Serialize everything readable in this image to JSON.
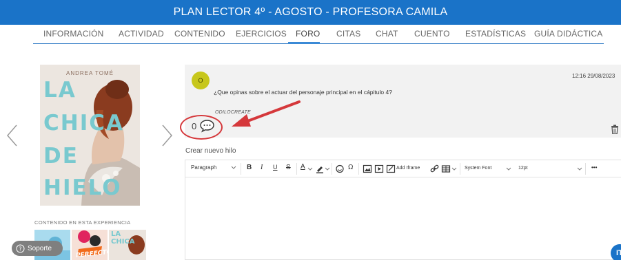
{
  "header": {
    "title": "PLAN LECTOR 4º - AGOSTO - PROFESORA CAMILA"
  },
  "tabs": [
    {
      "label": "INFORMACIÓN"
    },
    {
      "label": "ACTIVIDAD"
    },
    {
      "label": "CONTENIDO"
    },
    {
      "label": "EJERCICIOS"
    },
    {
      "label": "FORO",
      "active": true
    },
    {
      "label": "CITAS"
    },
    {
      "label": "CHAT"
    },
    {
      "label": "CUENTO"
    },
    {
      "label": "ESTADÍSTICAS"
    },
    {
      "label": "GUÍA DIDÁCTICA"
    }
  ],
  "book": {
    "author": "ANDREA TOMÉ",
    "title_lines": [
      "LA",
      "CHICA",
      "DE",
      "HIELO"
    ]
  },
  "experience": {
    "label": "CONTENIDO EN ESTA EXPERIENCIA",
    "thumbs": [
      {
        "text": "PERFECTOS"
      },
      {
        "text": "LA CHICA"
      }
    ]
  },
  "support": {
    "label": "Soporte"
  },
  "post": {
    "avatar_initial": "O",
    "timestamp": "12:16 29/08/2023",
    "question": "¿Que opinas sobre el actuar del personaje principal en el cápitulo 4?",
    "author": "ODILOCREATE",
    "reply_count": "0"
  },
  "new_thread": {
    "label": "Crear nuevo hilo"
  },
  "editor": {
    "block_format": "Paragraph",
    "bold": "B",
    "italic": "I",
    "underline": "U",
    "strike": "S",
    "text_color": "A",
    "omega": "Ω",
    "add_iframe": "Add Iframe",
    "font_family": "System Font",
    "font_size": "12pt",
    "more": "•••"
  },
  "help_fab": {
    "label": "IT"
  },
  "colors": {
    "brand": "#1a73c8",
    "accent_ring": "#d5383b",
    "avatar": "#c7c71c",
    "book_title": "#79c9cf"
  }
}
